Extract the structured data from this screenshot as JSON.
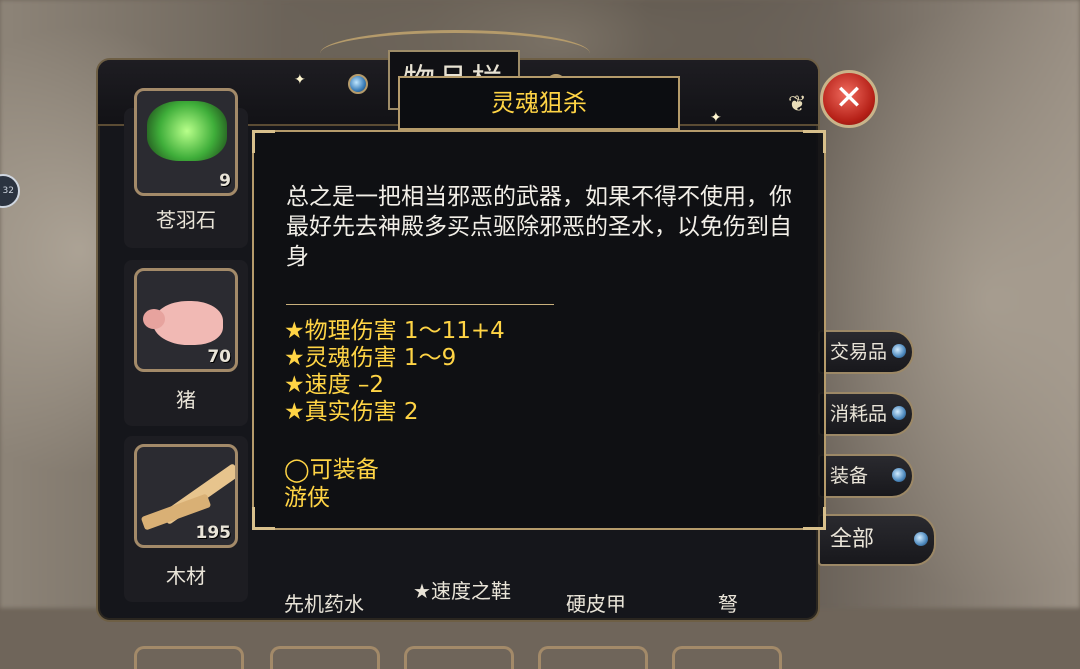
{
  "window": {
    "title": "物品栏"
  },
  "inventory": {
    "items": [
      {
        "name": "苍羽石",
        "qty": "9",
        "icon": "green-stone-icon"
      },
      {
        "name": "猪",
        "qty": "70",
        "icon": "pig-icon"
      },
      {
        "name": "木材",
        "qty": "195",
        "icon": "wood-icon"
      }
    ],
    "bottom_row_labels": [
      "先机药水",
      "★速度之鞋",
      "硬皮甲",
      "弩"
    ]
  },
  "tabs": [
    {
      "label": "交易品"
    },
    {
      "label": "消耗品"
    },
    {
      "label": "装备"
    },
    {
      "label": "全部"
    }
  ],
  "tooltip": {
    "title": "灵魂狙杀",
    "description": "总之是一把相当邪恶的武器，如果不得不使用，你最好先去神殿多买点驱除邪恶的圣水，以免伤到自身",
    "stats": [
      "★物理伤害 1～11+4",
      "★灵魂伤害 1～9",
      "★速度 –2",
      "★真实伤害 2"
    ],
    "equip_status": "◯可装备",
    "class": "游侠"
  },
  "colors": {
    "accent_gold": "#ffd445",
    "frame": "#b59b6b",
    "close_red": "#c0261c"
  }
}
